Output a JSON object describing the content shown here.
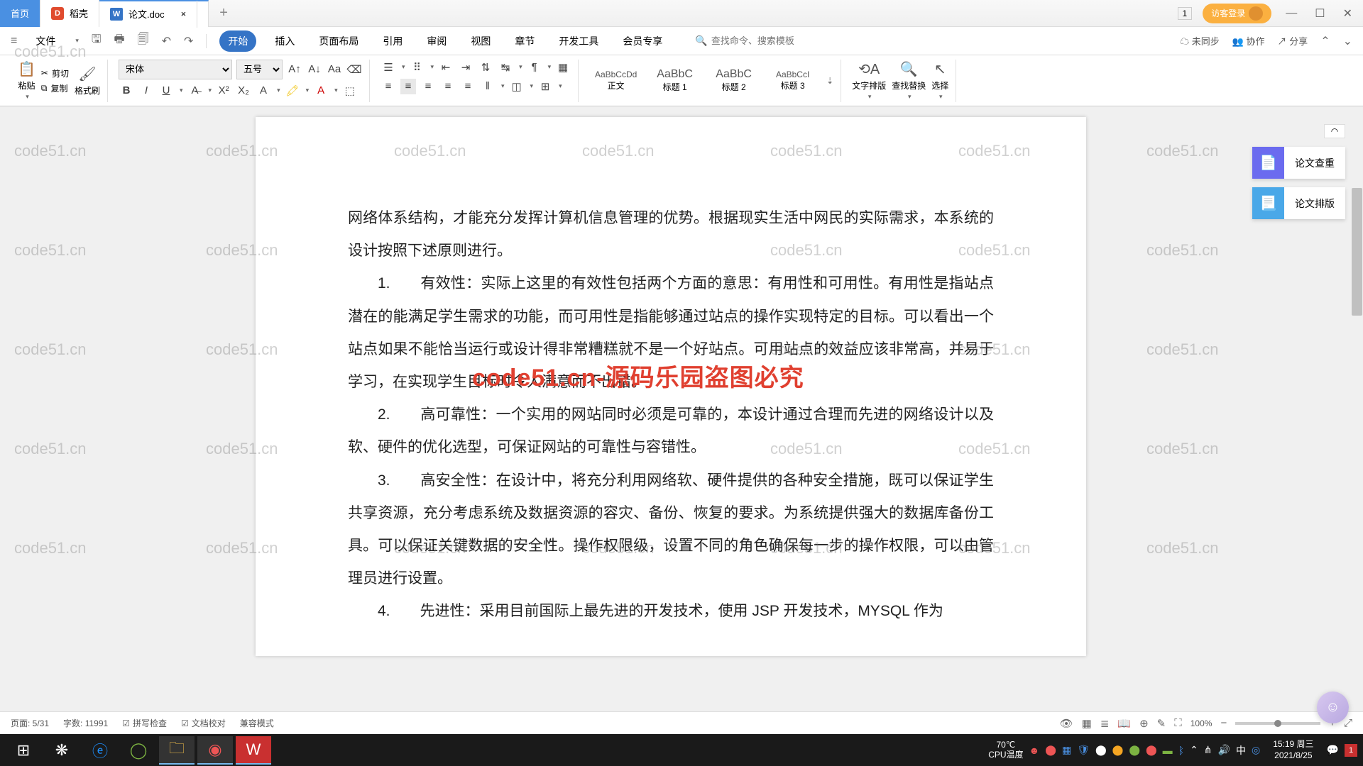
{
  "tabs": {
    "home": "首页",
    "daoke": "稻壳",
    "doc": "论文.doc",
    "close": "×",
    "add": "+"
  },
  "top": {
    "num": "1",
    "login": "访客登录"
  },
  "menu": {
    "file": "文件",
    "items": [
      "开始",
      "插入",
      "页面布局",
      "引用",
      "审阅",
      "视图",
      "章节",
      "开发工具",
      "会员专享"
    ],
    "search_ph": "查找命令、搜索模板",
    "sync": "未同步",
    "coop": "协作",
    "share": "分享"
  },
  "ribbon": {
    "paste": "粘贴",
    "cut": "剪切",
    "copy": "复制",
    "brush": "格式刷",
    "font_name": "宋体",
    "font_size": "五号",
    "styles": [
      {
        "prev": "AaBbCcDd",
        "label": "正文"
      },
      {
        "prev": "AaBbC",
        "label": "标题 1"
      },
      {
        "prev": "AaBbC",
        "label": "标题 2"
      },
      {
        "prev": "AaBbCcI",
        "label": "标题 3"
      }
    ],
    "layout": "文字排版",
    "replace": "查找替换",
    "select": "选择"
  },
  "doc": {
    "p0": "网络体系结构，才能充分发挥计算机信息管理的优势。根据现实生活中网民的实际需求，本系统的设计按照下述原则进行。",
    "i1_n": "1.",
    "i1": "有效性：实际上这里的有效性包括两个方面的意思：有用性和可用性。有用性是指站点潜在的能满足学生需求的功能，而可用性是指能够通过站点的操作实现特定的目标。可以看出一个站点如果不能恰当运行或设计得非常糟糕就不是一个好站点。可用站点的效益应该非常高，并易于学习，在实现学生目标时令人满意而不出错。",
    "i2_n": "2.",
    "i2": "高可靠性：一个实用的网站同时必须是可靠的，本设计通过合理而先进的网络设计以及软、硬件的优化选型，可保证网站的可靠性与容错性。",
    "i3_n": "3.",
    "i3": "高安全性：在设计中，将充分利用网络软、硬件提供的各种安全措施，既可以保证学生共享资源，充分考虑系统及数据资源的容灾、备份、恢复的要求。为系统提供强大的数据库备份工具。可以保证关键数据的安全性。操作权限级，设置不同的角色确保每一步的操作权限，可以由管理员进行设置。",
    "i4_n": "4.",
    "i4": "先进性：采用目前国际上最先进的开发技术，使用 JSP 开发技术，MYSQL 作为"
  },
  "overlay": "code51.cn-源码乐园盗图必究",
  "side": {
    "check": "论文查重",
    "layout": "论文排版"
  },
  "status": {
    "page": "页面: 5/31",
    "words": "字数: 11991",
    "spell": "拼写检查",
    "proof": "文档校对",
    "compat": "兼容模式",
    "zoom": "100%"
  },
  "tray": {
    "temp_deg": "70℃",
    "temp": "CPU温度",
    "time": "15:19 周三",
    "date": "2021/8/25",
    "lang": "中",
    "notif": "1"
  },
  "wm": "code51.cn"
}
